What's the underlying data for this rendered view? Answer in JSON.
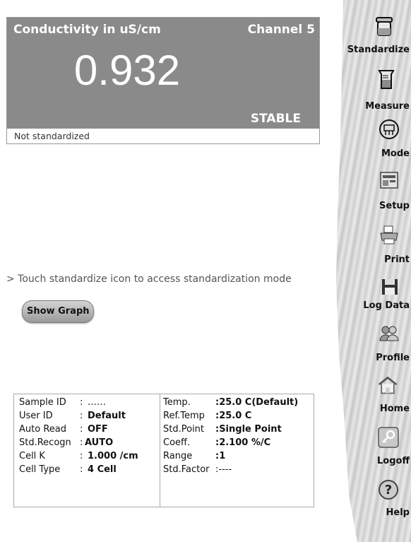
{
  "reading": {
    "parameter": "Conductivity  in  uS/cm",
    "channel": "Channel 5",
    "value": "0.932",
    "status": "STABLE",
    "standardization": "Not standardized"
  },
  "hint": "> Touch standardize icon to access standardization mode",
  "graph_button": "Show Graph",
  "info": {
    "left": [
      {
        "label": "Sample ID",
        "sep": ":",
        "value": "……"
      },
      {
        "label": "User ID",
        "sep": ":",
        "value": "Default"
      },
      {
        "label": "Auto Read",
        "sep": ":",
        "value": "OFF"
      },
      {
        "label": "Std.Recogn",
        "sep": ":",
        "value": "AUTO"
      },
      {
        "label": "Cell K",
        "sep": ":",
        "value": "1.000 /cm"
      },
      {
        "label": "Cell Type",
        "sep": ":",
        "value": "4 Cell"
      }
    ],
    "right": [
      {
        "label": "Temp.",
        "value": ":25.0 C(Default)"
      },
      {
        "label": "Ref.Temp",
        "value": ":25.0 C"
      },
      {
        "label": "Std.Point",
        "value": ":Single Point"
      },
      {
        "label": "Coeff.",
        "value": ":2.100 %/C"
      },
      {
        "label": "Range",
        "value": ":1"
      },
      {
        "label": "Std.Factor",
        "value": ":----"
      }
    ]
  },
  "toolbar": {
    "standardize": "Standardize",
    "measure": "Measure",
    "mode": "Mode",
    "setup": "Setup",
    "print": "Print",
    "log_data": "Log Data",
    "profile": "Profile",
    "home": "Home",
    "logoff": "Logoff",
    "help": "Help"
  }
}
